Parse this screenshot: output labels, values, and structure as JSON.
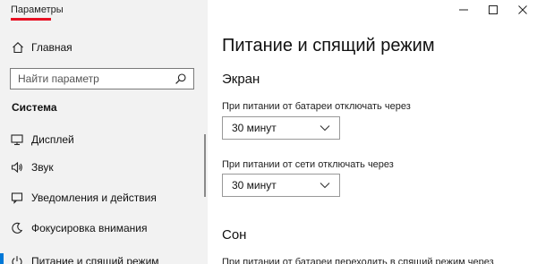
{
  "window": {
    "title": "Параметры",
    "accent_color": "#e81123",
    "controls": {
      "minimize": "minimize-icon",
      "maximize": "maximize-icon",
      "close": "close-icon"
    }
  },
  "sidebar": {
    "home": {
      "label": "Главная",
      "icon": "home-icon"
    },
    "search": {
      "placeholder": "Найти параметр",
      "icon": "search-icon"
    },
    "section_label": "Система",
    "items": [
      {
        "label": "Дисплей",
        "icon": "display-icon",
        "selected": false
      },
      {
        "label": "Звук",
        "icon": "speaker-icon",
        "selected": false
      },
      {
        "label": "Уведомления и действия",
        "icon": "notification-icon",
        "selected": false
      },
      {
        "label": "Фокусировка внимания",
        "icon": "focus-assist-icon",
        "selected": false
      },
      {
        "label": "Питание и спящий режим",
        "icon": "power-icon",
        "selected": true
      }
    ],
    "selected_color": "#0078d7"
  },
  "main": {
    "page_title": "Питание и спящий режим",
    "screen": {
      "title": "Экран",
      "battery_label": "При питании от батареи отключать через",
      "battery_value": "30 минут",
      "plugged_label": "При питании от сети отключать через",
      "plugged_value": "30 минут"
    },
    "sleep": {
      "title": "Сон",
      "battery_label": "При питании от батареи переходить в спящий режим через"
    }
  }
}
